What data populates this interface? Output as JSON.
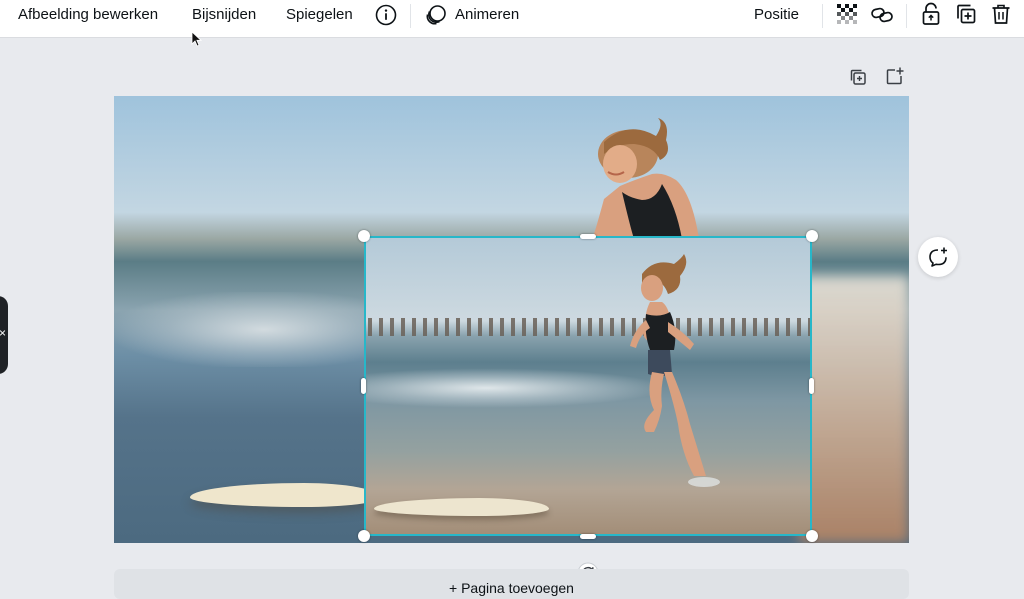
{
  "toolbar": {
    "edit_image": "Afbeelding bewerken",
    "crop": "Bijsnijden",
    "flip": "Spiegelen",
    "animate": "Animeren",
    "position": "Positie",
    "icons": [
      "info-icon",
      "animate-icon",
      "transparency-icon",
      "link-icon",
      "lock-icon",
      "duplicate-icon",
      "trash-icon"
    ]
  },
  "canvas": {
    "page_tools": [
      "copy-page-icon",
      "add-page-icon"
    ],
    "add_page_label": "+ Pagina toevoegen",
    "side_tab_glyph": "×",
    "icons": [
      "add-comment-icon",
      "rotate-icon"
    ]
  },
  "colors": {
    "selection": "#27b7c9",
    "toolbar_bg": "#ffffff",
    "workspace_bg": "#e8eaee"
  }
}
